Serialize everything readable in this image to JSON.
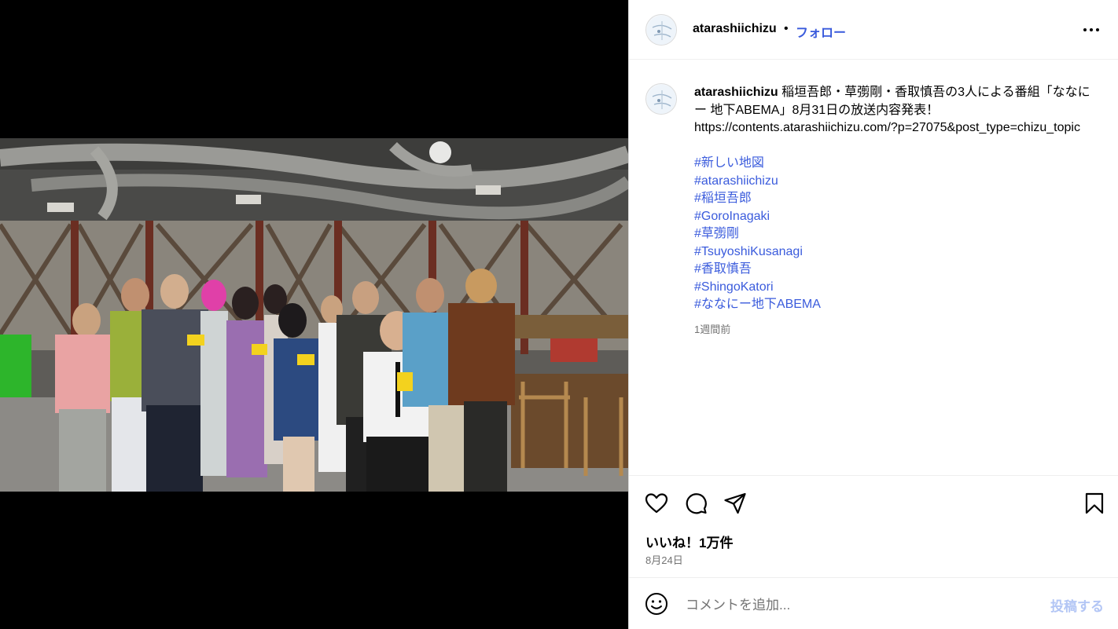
{
  "post": {
    "username": "atarashiichizu",
    "separator": "•",
    "follow_label": "フォロー",
    "caption_username": "atarashiichizu",
    "caption_text": "稲垣吾郎・草彅剛・香取慎吾の3人による番組「ななにー 地下ABEMA」8月31日の放送内容発表！",
    "caption_link": "https://contents.atarashiichizu.com/?p=27075&post_type=chizu_topic",
    "hashtags": [
      "#新しい地図",
      "#atarashiichizu",
      "#稲垣吾郎",
      "#GoroInagaki",
      "#草彅剛",
      "#TsuyoshiKusanagi",
      "#香取慎吾",
      "#ShingoKatori",
      "#ななにー地下ABEMA"
    ],
    "caption_time": "1週間前",
    "likes": "いいね！1万件",
    "date": "8月24日"
  },
  "comment": {
    "placeholder": "コメントを追加...",
    "post_label": "投稿する"
  },
  "icons": {
    "more": "more-horizontal-icon",
    "like": "heart-icon",
    "comment": "comment-icon",
    "share": "send-icon",
    "save": "bookmark-icon",
    "emoji": "emoji-icon"
  },
  "colors": {
    "link": "#3a5bdc",
    "muted": "#737373",
    "post_button_disabled": "#b3c6f5"
  }
}
